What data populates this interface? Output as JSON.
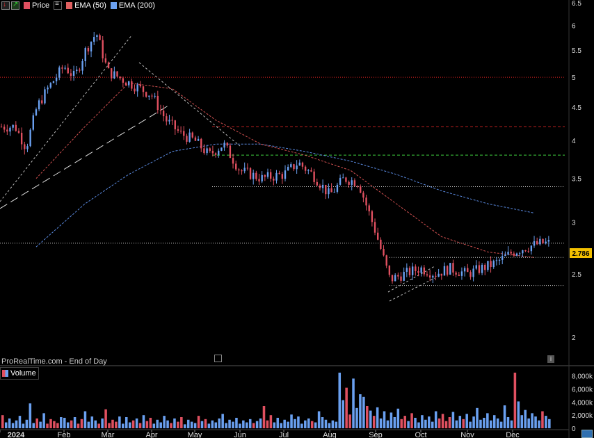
{
  "legend": {
    "price_label": "Price",
    "ema50_label": "EMA (50)",
    "ema200_label": "EMA (200)",
    "volume_label": "Volume",
    "price_color": "#e05060",
    "ema50_color": "#e06060",
    "ema200_color": "#6aa0f0"
  },
  "watermark": "ProRealTime.com - End of Day",
  "last_price_label": "2.786",
  "chart_data": [
    {
      "type": "candlestick",
      "title": "",
      "scale": "log",
      "ylim": [
        1.9,
        6.5
      ],
      "y_ticks": [
        "6.5",
        "6",
        "5.5",
        "5",
        "4.5",
        "4",
        "3.5",
        "3",
        "2.5",
        "2"
      ],
      "x_ticks": [
        "2024",
        "Feb",
        "Mar",
        "Apr",
        "May",
        "Jun",
        "Jul",
        "Aug",
        "Sep",
        "Oct",
        "Nov",
        "Dec"
      ],
      "grid": false,
      "last_value": 2.786,
      "series": [
        {
          "name": "Price",
          "points": [
            [
              "Jan",
              4.2
            ],
            [
              "Jan",
              3.9
            ],
            [
              "Jan",
              4.5
            ],
            [
              "Jan",
              4.8
            ],
            [
              "Feb",
              5.2
            ],
            [
              "Feb",
              5.0
            ],
            [
              "Feb",
              5.5
            ],
            [
              "Feb",
              5.85
            ],
            [
              "Mar",
              5.1
            ],
            [
              "Mar",
              4.9
            ],
            [
              "Apr",
              4.7
            ],
            [
              "Apr",
              4.3
            ],
            [
              "Apr",
              4.1
            ],
            [
              "May",
              4.0
            ],
            [
              "May",
              3.8
            ],
            [
              "May",
              3.95
            ],
            [
              "Jun",
              3.6
            ],
            [
              "Jun",
              3.5
            ],
            [
              "Jul",
              3.55
            ],
            [
              "Jul",
              3.7
            ],
            [
              "Jul",
              3.55
            ],
            [
              "Aug",
              3.3
            ],
            [
              "Aug",
              3.5
            ],
            [
              "Aug",
              3.45
            ],
            [
              "Sep",
              2.9
            ],
            [
              "Sep",
              2.45
            ],
            [
              "Sep",
              2.5
            ],
            [
              "Oct",
              2.55
            ],
            [
              "Oct",
              2.5
            ],
            [
              "Oct",
              2.55
            ],
            [
              "Nov",
              2.5
            ],
            [
              "Nov",
              2.55
            ],
            [
              "Nov",
              2.6
            ],
            [
              "Dec",
              2.7
            ],
            [
              "Dec",
              2.75
            ],
            [
              "Dec",
              2.786
            ]
          ]
        },
        {
          "name": "EMA (50)",
          "style": "dashed",
          "points": [
            [
              "Jan",
              3.5
            ],
            [
              "Feb",
              4.2
            ],
            [
              "Mar",
              4.9
            ],
            [
              "Apr",
              4.8
            ],
            [
              "May",
              4.3
            ],
            [
              "Jun",
              3.95
            ],
            [
              "Jul",
              3.8
            ],
            [
              "Aug",
              3.6
            ],
            [
              "Sep",
              3.2
            ],
            [
              "Oct",
              2.85
            ],
            [
              "Nov",
              2.7
            ],
            [
              "Dec",
              2.65
            ]
          ]
        },
        {
          "name": "EMA (200)",
          "style": "dashed",
          "points": [
            [
              "Jan",
              2.75
            ],
            [
              "Feb",
              3.2
            ],
            [
              "Mar",
              3.55
            ],
            [
              "Apr",
              3.85
            ],
            [
              "May",
              3.95
            ],
            [
              "Jun",
              3.95
            ],
            [
              "Jul",
              3.85
            ],
            [
              "Aug",
              3.72
            ],
            [
              "Sep",
              3.55
            ],
            [
              "Oct",
              3.35
            ],
            [
              "Nov",
              3.2
            ],
            [
              "Dec",
              3.1
            ]
          ]
        }
      ],
      "horizontal_levels": [
        {
          "value": 5.0,
          "color": "#e02020",
          "style": "dotted"
        },
        {
          "value": 4.2,
          "color": "#c02020",
          "style": "dashed"
        },
        {
          "value": 3.8,
          "color": "#40d040",
          "style": "dashed"
        },
        {
          "value": 3.4,
          "color": "#cccccc",
          "style": "dotted"
        },
        {
          "value": 2.786,
          "color": "#cccccc",
          "style": "dotted"
        },
        {
          "value": 2.65,
          "color": "#cccccc",
          "style": "dotted"
        },
        {
          "value": 2.4,
          "color": "#cccccc",
          "style": "dotted"
        }
      ]
    },
    {
      "type": "bar",
      "title": "Volume",
      "ylim": [
        0,
        8500
      ],
      "y_ticks": [
        "8,000k",
        "6,000k",
        "4,000k",
        "2,000k",
        "0"
      ],
      "values_k": [
        2000,
        900,
        1500,
        800,
        1200,
        1900,
        700,
        1300,
        3800,
        800,
        1500,
        1000,
        2300,
        700,
        1400,
        1100,
        800,
        1700,
        1600,
        900,
        1200,
        1700,
        700,
        1400,
        2600,
        1000,
        1800,
        1200,
        700,
        1500,
        2900,
        800,
        1300,
        1000,
        1800,
        700,
        1700,
        900,
        1200,
        1500,
        800,
        2000,
        1100,
        1600,
        700,
        1300,
        900,
        1900,
        1200,
        800,
        1500,
        1000,
        1700,
        600,
        1300,
        1000,
        800,
        1900,
        1100,
        1400,
        700,
        1200,
        900,
        1500,
        2200,
        800,
        1300,
        1000,
        1600,
        700,
        1200,
        900,
        1400,
        800,
        1100,
        1500,
        3400,
        1200,
        2000,
        900,
        1600,
        800,
        1300,
        1000,
        2100,
        1400,
        1800,
        700,
        1200,
        1500,
        1100,
        900,
        2600,
        1700,
        1300,
        800,
        1200,
        1000,
        9100,
        4300,
        6200,
        2100,
        7600,
        3100,
        5200,
        4800,
        3400,
        2700,
        1900,
        3200,
        1500,
        2600,
        1200,
        2400,
        1700,
        3000,
        1400,
        1900,
        1100,
        2300,
        1600,
        900,
        2000,
        1300,
        1800,
        1000,
        2600,
        1500,
        2200,
        1100,
        1700,
        2500,
        1200,
        1900,
        1400,
        2200,
        1000,
        1800,
        3100,
        1300,
        1600,
        2300,
        1200,
        2000,
        1500,
        1000,
        3500,
        1700,
        1200,
        9500,
        4100,
        2000,
        2800,
        1500,
        2300,
        1800,
        1200,
        2600,
        1900,
        1400
      ],
      "colors": "up-blue/down-red"
    }
  ]
}
